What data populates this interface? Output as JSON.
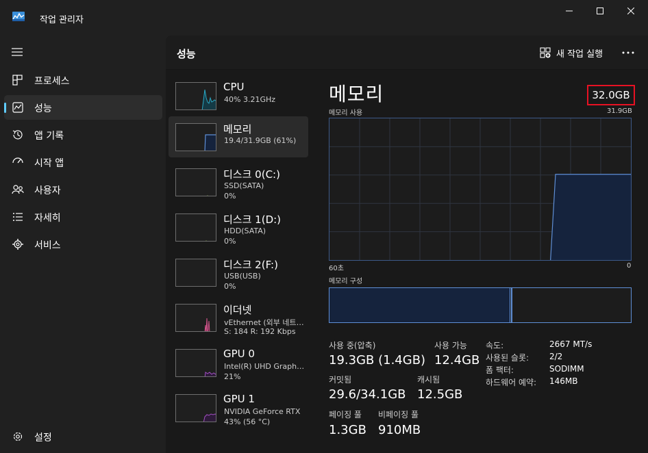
{
  "window": {
    "title": "작업 관리자",
    "minimize_icon": "minimize-icon",
    "maximize_icon": "maximize-icon",
    "close_icon": "close-icon"
  },
  "nav": {
    "items": [
      {
        "label": "프로세스",
        "icon": "processes-icon"
      },
      {
        "label": "성능",
        "icon": "performance-icon",
        "active": true
      },
      {
        "label": "앱 기록",
        "icon": "history-icon"
      },
      {
        "label": "시작 앱",
        "icon": "startup-icon"
      },
      {
        "label": "사용자",
        "icon": "users-icon"
      },
      {
        "label": "자세히",
        "icon": "details-icon"
      },
      {
        "label": "서비스",
        "icon": "services-icon"
      }
    ],
    "settings_label": "설정"
  },
  "header": {
    "title": "성능",
    "run_task_label": "새 작업 실행"
  },
  "devices": [
    {
      "name": "CPU",
      "line1": "40%  3.21GHz",
      "line2": ""
    },
    {
      "name": "메모리",
      "line1": "19.4/31.9GB (61%)",
      "line2": ""
    },
    {
      "name": "디스크 0(C:)",
      "line1": "SSD(SATA)",
      "line2": "0%"
    },
    {
      "name": "디스크 1(D:)",
      "line1": "HDD(SATA)",
      "line2": "0%"
    },
    {
      "name": "디스크 2(F:)",
      "line1": "USB(USB)",
      "line2": "0%"
    },
    {
      "name": "이더넷",
      "line1": "vEthernet (외부 네트워크)",
      "line2": "S: 184  R: 192 Kbps"
    },
    {
      "name": "GPU 0",
      "line1": "Intel(R) UHD Graphics",
      "line2": "21%"
    },
    {
      "name": "GPU 1",
      "line1": "NVIDIA GeForce RTX",
      "line2": "43%  (56 °C)"
    }
  ],
  "colors": {
    "cpu": "#2aa8c4",
    "memory": "#5f8fd6",
    "disk": "#8fb84a",
    "ethernet": "#d2558c",
    "gpu": "#a34fc4"
  },
  "detail": {
    "title": "메모리",
    "total": "32.0GB",
    "usage_label": "메모리 사용",
    "usage_max": "31.9GB",
    "time_start": "60초",
    "time_end": "0",
    "composition_label": "메모리 구성",
    "used_fraction": 0.6,
    "modified_fraction": 0.005
  },
  "chart_data": {
    "type": "area",
    "title": "메모리 사용",
    "x": [
      60,
      59,
      58,
      57,
      56,
      55,
      54,
      53,
      52,
      51,
      50,
      49,
      48,
      47,
      46,
      45,
      44,
      43,
      42,
      41,
      40,
      39,
      38,
      37,
      36,
      35,
      34,
      33,
      32,
      31,
      30,
      29,
      28,
      27,
      26,
      25,
      24,
      23,
      22,
      21,
      20,
      19,
      18,
      17,
      16,
      15,
      14,
      13,
      12,
      11,
      10,
      9,
      8,
      7,
      6,
      5,
      4,
      3,
      2,
      1,
      0
    ],
    "values": [
      null,
      null,
      null,
      null,
      null,
      null,
      null,
      null,
      null,
      null,
      null,
      null,
      null,
      null,
      null,
      null,
      null,
      null,
      null,
      null,
      null,
      null,
      null,
      null,
      null,
      null,
      null,
      null,
      null,
      null,
      null,
      null,
      null,
      null,
      null,
      null,
      null,
      null,
      null,
      null,
      null,
      null,
      null,
      null,
      0,
      19.3,
      19.3,
      19.3,
      19.3,
      19.3,
      19.3,
      19.3,
      19.3,
      19.3,
      19.3,
      19.3,
      19.3,
      19.3,
      19.3,
      19.3,
      19.3
    ],
    "xlim": [
      60,
      0
    ],
    "ylim": [
      0,
      31.9
    ],
    "unit": "GB"
  },
  "stats": {
    "in_use_label": "사용 중(압축)",
    "in_use_value": "19.3GB (1.4GB)",
    "available_label": "사용 가능",
    "available_value": "12.4GB",
    "committed_label": "커밋됨",
    "committed_value": "29.6/34.1GB",
    "cached_label": "캐시됨",
    "cached_value": "12.5GB",
    "paged_label": "페이징 풀",
    "paged_value": "1.3GB",
    "nonpaged_label": "비페이징 풀",
    "nonpaged_value": "910MB"
  },
  "specs": [
    {
      "key": "속도:",
      "value": "2667 MT/s"
    },
    {
      "key": "사용된 슬롯:",
      "value": "2/2"
    },
    {
      "key": "폼 팩터:",
      "value": "SODIMM"
    },
    {
      "key": "하드웨어 예약:",
      "value": "146MB"
    }
  ]
}
